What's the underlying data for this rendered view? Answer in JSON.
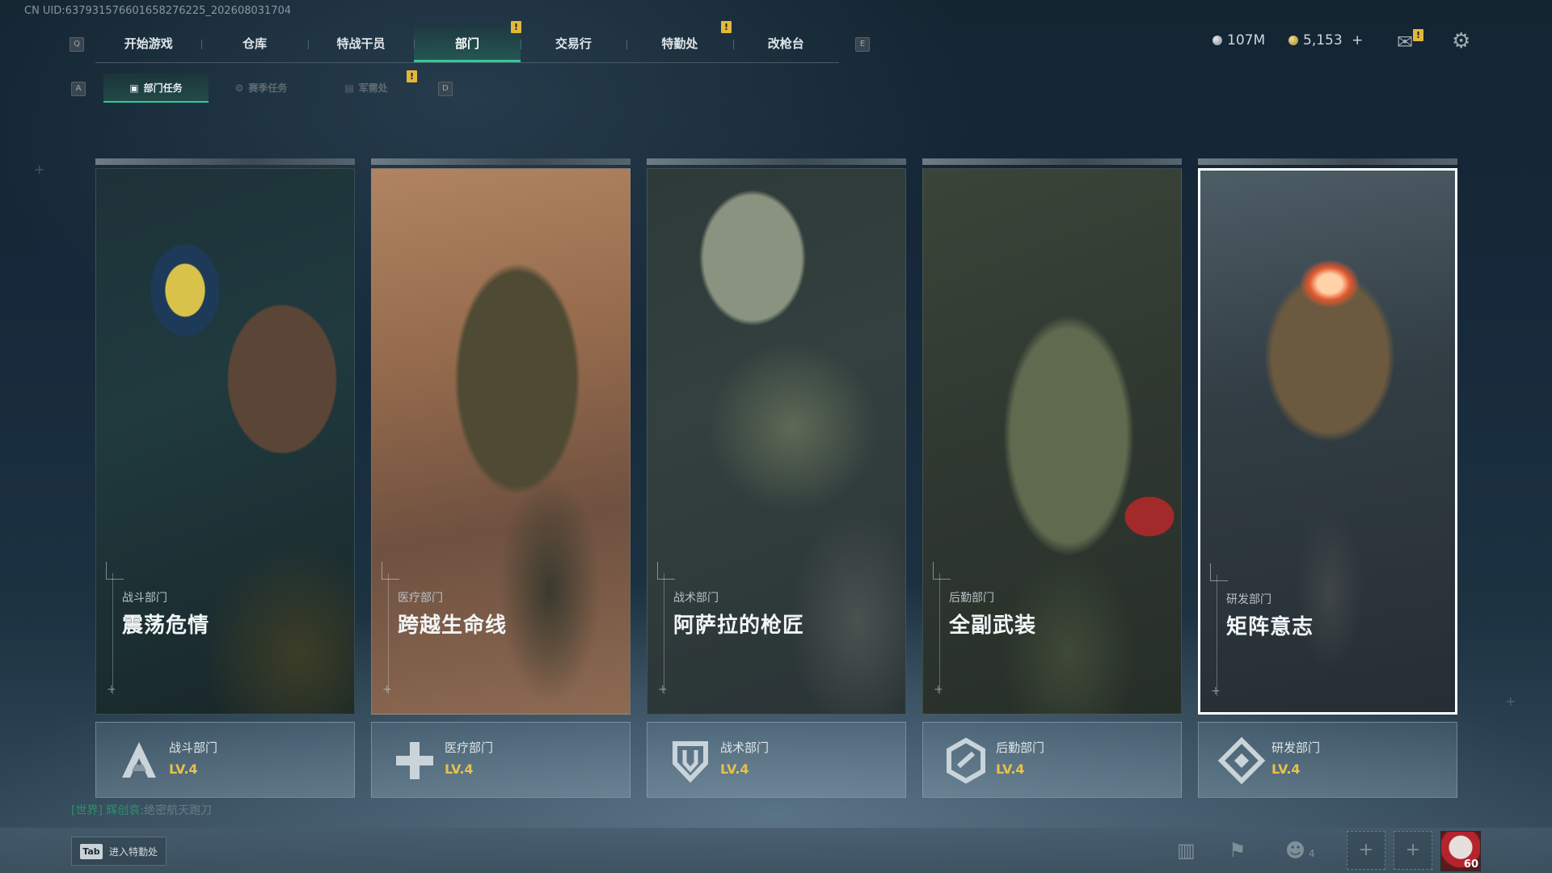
{
  "uid": "CN UID:637931576601658276225_202608031704",
  "keys": {
    "q": "Q",
    "e": "E",
    "a": "A",
    "d": "D"
  },
  "nav": {
    "tabs": [
      "开始游戏",
      "仓库",
      "特战干员",
      "部门",
      "交易行",
      "特勤处",
      "改枪台"
    ],
    "active": "部门"
  },
  "subnav": {
    "items": [
      "部门任务",
      "赛季任务",
      "军需处"
    ],
    "active": "部门任务"
  },
  "currency": {
    "silver": "107M",
    "gold": "5,153",
    "gold_plus": "+"
  },
  "warn_mark": "!",
  "cards": [
    {
      "dept": "战斗部门",
      "title": "震荡危情",
      "level": "LV.4",
      "emblem": "combat-emblem-icon"
    },
    {
      "dept": "医疗部门",
      "title": "跨越生命线",
      "level": "LV.4",
      "emblem": "medical-emblem-icon"
    },
    {
      "dept": "战术部门",
      "title": "阿萨拉的枪匠",
      "level": "LV.4",
      "emblem": "tactical-emblem-icon"
    },
    {
      "dept": "后勤部门",
      "title": "全副武装",
      "level": "LV.4",
      "emblem": "logistics-emblem-icon"
    },
    {
      "dept": "研发部门",
      "title": "矩阵意志",
      "level": "LV.4",
      "emblem": "rnd-emblem-icon"
    }
  ],
  "selected_card": 4,
  "world_chat": {
    "channel": "[世界]",
    "sender": "辉创哀:",
    "message": "绝密航天跑刀"
  },
  "bottom": {
    "tab_key": "Tab",
    "tab_label": "进入特勤处",
    "friends_count": "4",
    "avatar_level": "60"
  },
  "colors": {
    "accent": "#35c79a",
    "level": "#e8c14a",
    "warning": "#e2b83a"
  }
}
